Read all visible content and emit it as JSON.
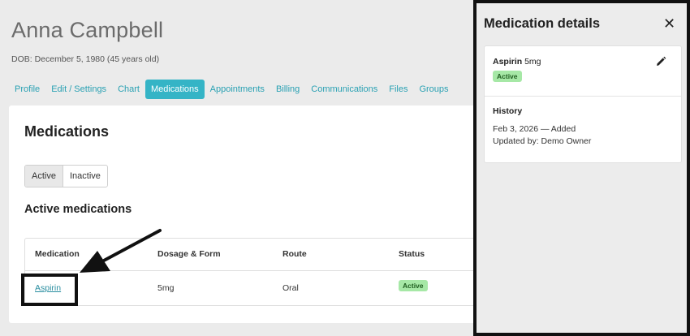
{
  "patient": {
    "name": "Anna Campbell",
    "dob": "DOB: December 5, 1980 (45 years old)"
  },
  "tabs": [
    {
      "label": "Profile",
      "active": false
    },
    {
      "label": "Edit / Settings",
      "active": false
    },
    {
      "label": "Chart",
      "active": false
    },
    {
      "label": "Medications",
      "active": true
    },
    {
      "label": "Appointments",
      "active": false
    },
    {
      "label": "Billing",
      "active": false
    },
    {
      "label": "Communications",
      "active": false
    },
    {
      "label": "Files",
      "active": false
    },
    {
      "label": "Groups",
      "active": false
    }
  ],
  "main": {
    "title": "Medications",
    "filter": {
      "active_label": "Active",
      "inactive_label": "Inactive",
      "selected": "Active"
    },
    "section_title": "Active medications",
    "table": {
      "headers": [
        "Medication",
        "Dosage & Form",
        "Route",
        "Status"
      ],
      "rows": [
        {
          "medication": "Aspirin",
          "dosage": "5mg",
          "route": "Oral",
          "status": "Active"
        }
      ]
    }
  },
  "panel": {
    "title": "Medication details",
    "close_icon": "close-icon",
    "medication_name": "Aspirin",
    "medication_dose": "5mg",
    "status": "Active",
    "edit_icon": "pencil-icon",
    "history_label": "History",
    "history_entry": "Feb 3, 2026 — Added",
    "updated_by": "Updated by: Demo Owner"
  },
  "colors": {
    "accent": "#35b4c6",
    "link": "#2a8ea0",
    "status_active_bg": "#a6e8a6",
    "annotation": "#111111"
  }
}
